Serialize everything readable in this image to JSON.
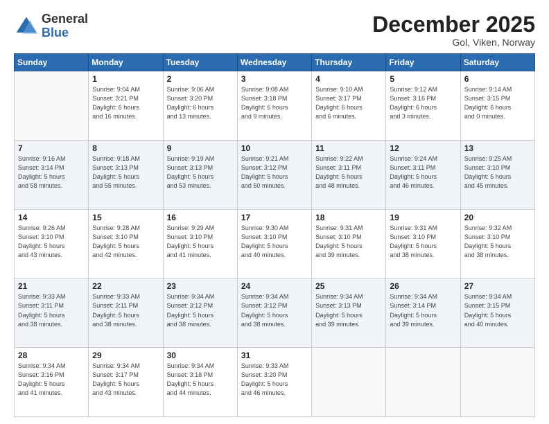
{
  "logo": {
    "general": "General",
    "blue": "Blue"
  },
  "title": {
    "month": "December 2025",
    "location": "Gol, Viken, Norway"
  },
  "days_of_week": [
    "Sunday",
    "Monday",
    "Tuesday",
    "Wednesday",
    "Thursday",
    "Friday",
    "Saturday"
  ],
  "weeks": [
    [
      {
        "day": "",
        "info": ""
      },
      {
        "day": "1",
        "info": "Sunrise: 9:04 AM\nSunset: 3:21 PM\nDaylight: 6 hours\nand 16 minutes."
      },
      {
        "day": "2",
        "info": "Sunrise: 9:06 AM\nSunset: 3:20 PM\nDaylight: 6 hours\nand 13 minutes."
      },
      {
        "day": "3",
        "info": "Sunrise: 9:08 AM\nSunset: 3:18 PM\nDaylight: 6 hours\nand 9 minutes."
      },
      {
        "day": "4",
        "info": "Sunrise: 9:10 AM\nSunset: 3:17 PM\nDaylight: 6 hours\nand 6 minutes."
      },
      {
        "day": "5",
        "info": "Sunrise: 9:12 AM\nSunset: 3:16 PM\nDaylight: 6 hours\nand 3 minutes."
      },
      {
        "day": "6",
        "info": "Sunrise: 9:14 AM\nSunset: 3:15 PM\nDaylight: 6 hours\nand 0 minutes."
      }
    ],
    [
      {
        "day": "7",
        "info": "Sunrise: 9:16 AM\nSunset: 3:14 PM\nDaylight: 5 hours\nand 58 minutes."
      },
      {
        "day": "8",
        "info": "Sunrise: 9:18 AM\nSunset: 3:13 PM\nDaylight: 5 hours\nand 55 minutes."
      },
      {
        "day": "9",
        "info": "Sunrise: 9:19 AM\nSunset: 3:13 PM\nDaylight: 5 hours\nand 53 minutes."
      },
      {
        "day": "10",
        "info": "Sunrise: 9:21 AM\nSunset: 3:12 PM\nDaylight: 5 hours\nand 50 minutes."
      },
      {
        "day": "11",
        "info": "Sunrise: 9:22 AM\nSunset: 3:11 PM\nDaylight: 5 hours\nand 48 minutes."
      },
      {
        "day": "12",
        "info": "Sunrise: 9:24 AM\nSunset: 3:11 PM\nDaylight: 5 hours\nand 46 minutes."
      },
      {
        "day": "13",
        "info": "Sunrise: 9:25 AM\nSunset: 3:10 PM\nDaylight: 5 hours\nand 45 minutes."
      }
    ],
    [
      {
        "day": "14",
        "info": "Sunrise: 9:26 AM\nSunset: 3:10 PM\nDaylight: 5 hours\nand 43 minutes."
      },
      {
        "day": "15",
        "info": "Sunrise: 9:28 AM\nSunset: 3:10 PM\nDaylight: 5 hours\nand 42 minutes."
      },
      {
        "day": "16",
        "info": "Sunrise: 9:29 AM\nSunset: 3:10 PM\nDaylight: 5 hours\nand 41 minutes."
      },
      {
        "day": "17",
        "info": "Sunrise: 9:30 AM\nSunset: 3:10 PM\nDaylight: 5 hours\nand 40 minutes."
      },
      {
        "day": "18",
        "info": "Sunrise: 9:31 AM\nSunset: 3:10 PM\nDaylight: 5 hours\nand 39 minutes."
      },
      {
        "day": "19",
        "info": "Sunrise: 9:31 AM\nSunset: 3:10 PM\nDaylight: 5 hours\nand 38 minutes."
      },
      {
        "day": "20",
        "info": "Sunrise: 9:32 AM\nSunset: 3:10 PM\nDaylight: 5 hours\nand 38 minutes."
      }
    ],
    [
      {
        "day": "21",
        "info": "Sunrise: 9:33 AM\nSunset: 3:11 PM\nDaylight: 5 hours\nand 38 minutes."
      },
      {
        "day": "22",
        "info": "Sunrise: 9:33 AM\nSunset: 3:11 PM\nDaylight: 5 hours\nand 38 minutes."
      },
      {
        "day": "23",
        "info": "Sunrise: 9:34 AM\nSunset: 3:12 PM\nDaylight: 5 hours\nand 38 minutes."
      },
      {
        "day": "24",
        "info": "Sunrise: 9:34 AM\nSunset: 3:12 PM\nDaylight: 5 hours\nand 38 minutes."
      },
      {
        "day": "25",
        "info": "Sunrise: 9:34 AM\nSunset: 3:13 PM\nDaylight: 5 hours\nand 39 minutes."
      },
      {
        "day": "26",
        "info": "Sunrise: 9:34 AM\nSunset: 3:14 PM\nDaylight: 5 hours\nand 39 minutes."
      },
      {
        "day": "27",
        "info": "Sunrise: 9:34 AM\nSunset: 3:15 PM\nDaylight: 5 hours\nand 40 minutes."
      }
    ],
    [
      {
        "day": "28",
        "info": "Sunrise: 9:34 AM\nSunset: 3:16 PM\nDaylight: 5 hours\nand 41 minutes."
      },
      {
        "day": "29",
        "info": "Sunrise: 9:34 AM\nSunset: 3:17 PM\nDaylight: 5 hours\nand 43 minutes."
      },
      {
        "day": "30",
        "info": "Sunrise: 9:34 AM\nSunset: 3:18 PM\nDaylight: 5 hours\nand 44 minutes."
      },
      {
        "day": "31",
        "info": "Sunrise: 9:33 AM\nSunset: 3:20 PM\nDaylight: 5 hours\nand 46 minutes."
      },
      {
        "day": "",
        "info": ""
      },
      {
        "day": "",
        "info": ""
      },
      {
        "day": "",
        "info": ""
      }
    ]
  ]
}
